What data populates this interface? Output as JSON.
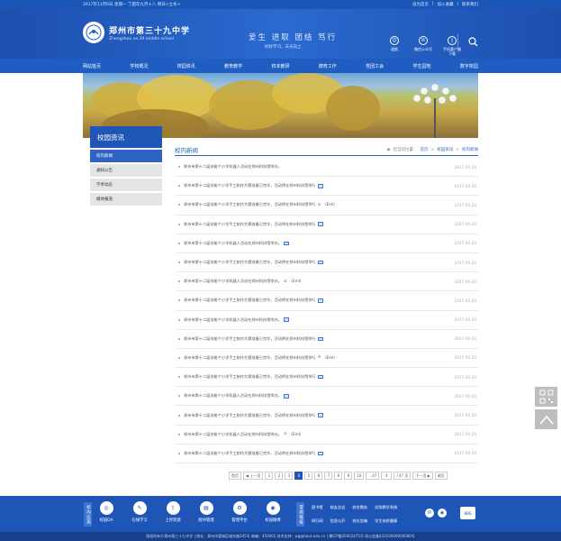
{
  "topbar": {
    "date": "2017年11月6日 星期一 丁酉年九月十八 明日<立冬>",
    "links": [
      "设为首页",
      "加入收藏",
      "联系我们"
    ]
  },
  "header": {
    "school_cn": "郑州市第三十九中学",
    "school_en": "Zhengzhou no.39 middle school",
    "motto": "爱生 进取 团结 笃行",
    "slogan": "好好学习，天天向上",
    "icons": [
      {
        "label": "道航",
        "icon": "user-icon"
      },
      {
        "label": "微信公众号",
        "icon": "wechat-icon"
      },
      {
        "label": "手机客户端下载",
        "icon": "phone-icon"
      }
    ],
    "search_icon": "search-icon"
  },
  "nav": [
    "网站首页",
    "学校概况",
    "校园资讯",
    "教育教学",
    "校本教研",
    "德育工作",
    "党团工会",
    "学生园地",
    "数字校园"
  ],
  "sidebar": {
    "title": "校园资讯",
    "items": [
      "校内新闻",
      "通知公告",
      "学术动态",
      "媒体报道"
    ]
  },
  "main": {
    "title": "校内新闻",
    "crumb_prefix": "您当前位置：",
    "crumbs": [
      "首页",
      "校园资讯",
      "校内新闻"
    ],
    "news": [
      {
        "text": "郑州市第十二届技能个小学机器人活动在郑州科技馆举办。",
        "date": "2017-05-24",
        "attach": "",
        "pic": false
      },
      {
        "text": "郑州市第十二届技能个小学手工制作大赛准备已完毕，活动将在郑州科技馆举行",
        "date": "2017-05-24",
        "attach": "",
        "pic": true
      },
      {
        "text": "郑州市第十二届技能个小学手工制作大赛准备已完毕，活动将在郑州科技馆举行",
        "date": "2017-05-24",
        "attach": "（Eml）",
        "pic": false
      },
      {
        "text": "郑州市第十二届技能个小学手工制作大赛准备已完毕，活动将在郑州科技馆举行",
        "date": "2017-05-24",
        "attach": "",
        "pic": true
      },
      {
        "text": "郑州市第十二届技能个小学机器人活动在郑州科技馆举办。",
        "date": "2017-05-24",
        "attach": "",
        "pic": true
      },
      {
        "text": "郑州市第十二届技能个小学手工制作大赛准备已完毕，活动将在郑州科技馆举行",
        "date": "2017-05-24",
        "attach": "",
        "pic": true
      },
      {
        "text": "郑州市第十二届技能个小学机器人活动在郑州科技馆举办。",
        "date": "2017-05-24",
        "attach": "（Eml）",
        "pic": false
      },
      {
        "text": "郑州市第十二届技能个小学手工制作大赛准备已完毕，活动将在郑州科技馆举行",
        "date": "2017-05-24",
        "attach": "",
        "pic": true
      },
      {
        "text": "郑州市第十二届技能个小学机器人活动在郑州科技馆举办。",
        "date": "2017-05-24",
        "attach": "",
        "pic": true
      },
      {
        "text": "郑州市第十二届技能个小学手工制作大赛准备已完毕，活动将在郑州科技馆举行",
        "date": "2017-05-24",
        "attach": "",
        "pic": true
      },
      {
        "text": "郑州市第十二届技能个小学手工制作大赛准备已完毕，活动将在郑州科技馆举行",
        "date": "2017-05-24",
        "attach": "（Eml）",
        "pic": false
      },
      {
        "text": "郑州市第十二届技能个小学手工制作大赛准备已完毕，活动将在郑州科技馆举行",
        "date": "2017-05-24",
        "attach": "",
        "pic": true
      },
      {
        "text": "郑州市第十二届技能个小学机器人活动在郑州科技馆举办。",
        "date": "2017-05-24",
        "attach": "",
        "pic": true
      },
      {
        "text": "郑州市第十二届技能个小学手工制作大赛准备已完毕，活动将在郑州科技馆举行",
        "date": "2017-05-24",
        "attach": "",
        "pic": true
      },
      {
        "text": "郑州市第十二届技能个小学机器人活动在郑州科技馆举办。",
        "date": "2017-05-24",
        "attach": "（Eml）",
        "pic": false
      },
      {
        "text": "郑州市第十二届技能个小学手工制作大赛准备已完毕，活动将在郑州科技馆举行",
        "date": "2017-05-24",
        "attach": "",
        "pic": true
      }
    ]
  },
  "pager": {
    "items": [
      "首页",
      "◀ 上一页",
      "1",
      "2",
      "3",
      "4",
      "5",
      "6",
      "7",
      "8",
      "9",
      "10",
      "...47",
      "/ 47 页",
      "下一页 ▶",
      "尾页"
    ],
    "current": "4",
    "goto_value": "4"
  },
  "float": {
    "qr_icon": "qr-code-icon",
    "top_icon": "back-to-top-icon"
  },
  "footer": {
    "tag1": "校内应用",
    "tag2": "常用链接",
    "quick": [
      {
        "label": "校园OA",
        "icon": "oa-icon"
      },
      {
        "label": "在线学习",
        "icon": "study-icon"
      },
      {
        "label": "上传资源",
        "icon": "upload-icon"
      },
      {
        "label": "图书管理",
        "icon": "book-icon"
      },
      {
        "label": "管理平台",
        "icon": "platform-icon"
      },
      {
        "label": "校园微博",
        "icon": "weibo-icon"
      }
    ],
    "links": [
      "国书馆",
      "校友总会",
      "综合教务",
      "实践教学系统",
      "网行网",
      "信息公开",
      "校长信箱",
      "学生体质健康"
    ],
    "social": [
      "wechat-icon",
      "weibo-icon"
    ],
    "badge": "BBS",
    "copyright": "版权所有©郑州第三十九中学 | 地址：郑州市管城区城东路245号 邮编：450001 技术支持：wg@haut.edu.cn | 豫ICP备05002475号 网公信备41010000000080号"
  }
}
